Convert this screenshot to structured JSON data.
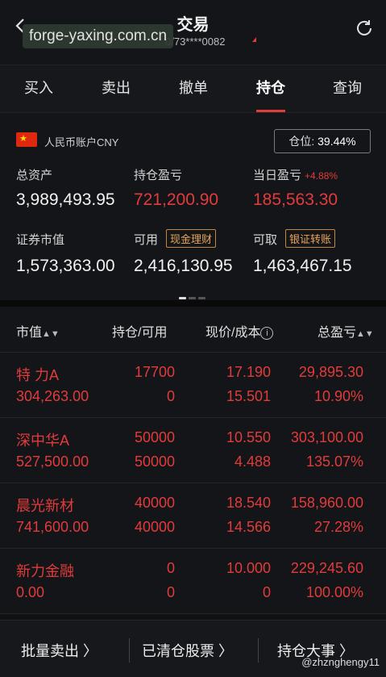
{
  "header": {
    "title": "交易",
    "account_mask": "0/73****0082",
    "watermark": "forge-yaxing.com.cn"
  },
  "tabs": [
    {
      "label": "买入"
    },
    {
      "label": "卖出"
    },
    {
      "label": "撤单"
    },
    {
      "label": "持仓",
      "active": true
    },
    {
      "label": "查询"
    }
  ],
  "summary": {
    "account_type": "人民币账户CNY",
    "position_label": "仓位:",
    "position_value": "39.44%",
    "total_assets_label": "总资产",
    "total_assets": "3,989,493.95",
    "holding_pl_label": "持仓盈亏",
    "holding_pl": "721,200.90",
    "daily_pl_label": "当日盈亏",
    "daily_pl_pct": "+4.88%",
    "daily_pl": "185,563.30",
    "market_value_label": "证券市值",
    "market_value": "1,573,363.00",
    "available_label": "可用",
    "available_tag": "现金理财",
    "available": "2,416,130.95",
    "withdrawable_label": "可取",
    "withdrawable_tag": "银证转账",
    "withdrawable": "1,463,467.15"
  },
  "table": {
    "headers": {
      "market_value": "市值",
      "holding": "持仓/可用",
      "price": "现价/成本",
      "total_pl": "总盈亏"
    },
    "rows": [
      {
        "name": "特 力A",
        "value": "304,263.00",
        "holding": "17700",
        "available": "0",
        "price": "17.190",
        "cost": "15.501",
        "pl": "29,895.30",
        "pl_pct": "10.90%"
      },
      {
        "name": "深中华A",
        "value": "527,500.00",
        "holding": "50000",
        "available": "50000",
        "price": "10.550",
        "cost": "4.488",
        "pl": "303,100.00",
        "pl_pct": "135.07%"
      },
      {
        "name": "晨光新材",
        "value": "741,600.00",
        "holding": "40000",
        "available": "40000",
        "price": "18.540",
        "cost": "14.566",
        "pl": "158,960.00",
        "pl_pct": "27.28%"
      },
      {
        "name": "新力金融",
        "value": "0.00",
        "holding": "0",
        "available": "0",
        "price": "10.000",
        "cost": "0",
        "pl": "229,245.60",
        "pl_pct": "100.00%"
      }
    ]
  },
  "bottom": {
    "batch_sell": "批量卖出",
    "cleared": "已清仓股票",
    "events": "持仓大事",
    "credit": "@zhznghengy11"
  },
  "colors": {
    "accent_red": "#e23b3b",
    "background": "#111214"
  }
}
